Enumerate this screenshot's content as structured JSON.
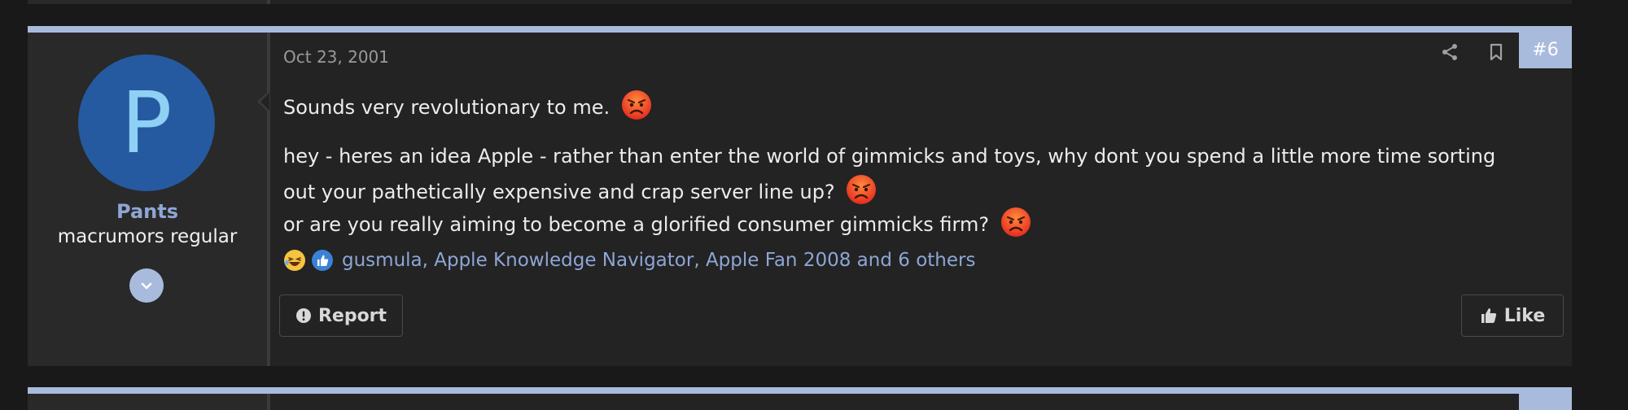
{
  "post": {
    "number": "#6",
    "date": "Oct 23, 2001",
    "author": {
      "avatar_letter": "P",
      "name": "Pants",
      "title": "macrumors regular"
    },
    "message": {
      "line1": "Sounds very revolutionary to me.",
      "line2": "hey - heres an idea Apple - rather than enter the world of gimmicks and toys, why dont you spend a little more time sorting",
      "line3": "out your pathetically expensive and crap server line up?",
      "line4": "or are you really aiming to become a glorified consumer gimmicks firm?"
    },
    "reactions": {
      "icons": [
        "laughing-emoji-icon",
        "thumbs-up-icon"
      ],
      "users_text": "gusmula, Apple Knowledge Navigator, Apple Fan 2008 and 6 others"
    },
    "actions": {
      "report_label": "Report",
      "like_label": "Like"
    }
  },
  "colors": {
    "accent": "#a8bbdc",
    "avatar_bg": "#255aa0",
    "username": "#8ea6d6",
    "post_bg": "#232323",
    "user_col_bg": "#292929"
  }
}
